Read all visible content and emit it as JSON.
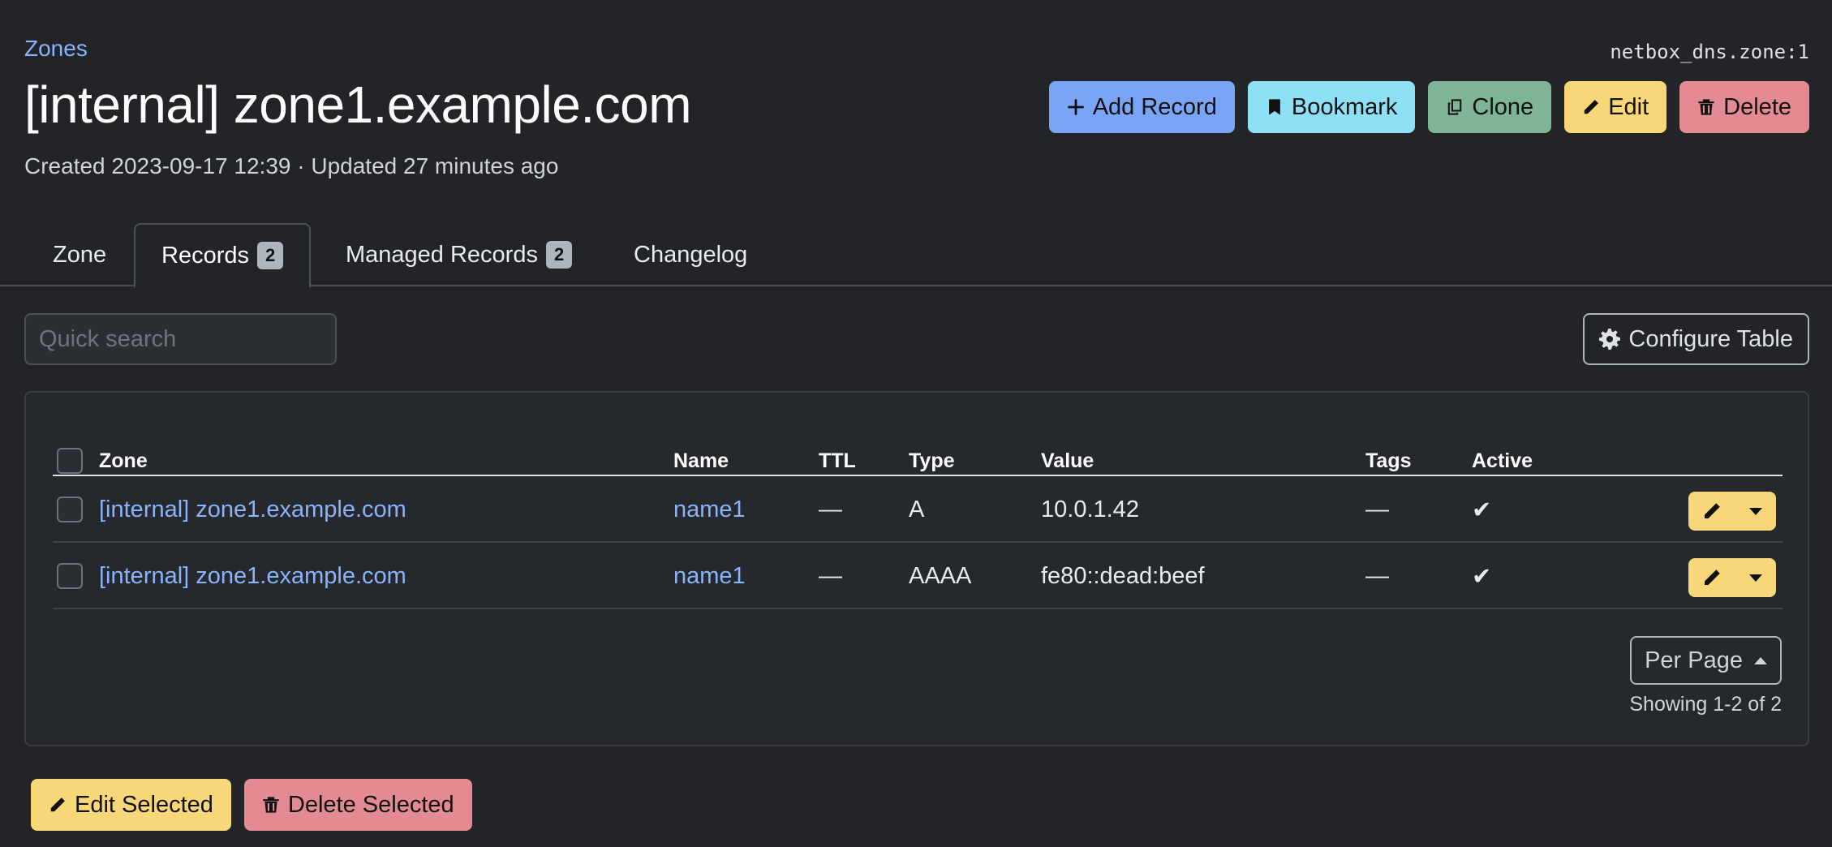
{
  "breadcrumb": "Zones",
  "object_id": "netbox_dns.zone:1",
  "title": "[internal] zone1.example.com",
  "meta": "Created 2023-09-17 12:39 · Updated 27 minutes ago",
  "actions": {
    "add_record": "Add Record",
    "bookmark": "Bookmark",
    "clone": "Clone",
    "edit": "Edit",
    "delete": "Delete"
  },
  "tabs": [
    {
      "label": "Zone",
      "badge": null
    },
    {
      "label": "Records",
      "badge": "2"
    },
    {
      "label": "Managed Records",
      "badge": "2"
    },
    {
      "label": "Changelog",
      "badge": null
    }
  ],
  "search": {
    "placeholder": "Quick search"
  },
  "configure_table": "Configure Table",
  "table": {
    "columns": [
      "Zone",
      "Name",
      "TTL",
      "Type",
      "Value",
      "Tags",
      "Active"
    ],
    "rows": [
      {
        "zone": "[internal] zone1.example.com",
        "name": "name1",
        "ttl": "—",
        "type": "A",
        "value": "10.0.1.42",
        "tags": "—",
        "active": "✔"
      },
      {
        "zone": "[internal] zone1.example.com",
        "name": "name1",
        "ttl": "—",
        "type": "AAAA",
        "value": "fe80::dead:beef",
        "tags": "—",
        "active": "✔"
      }
    ]
  },
  "pagination": {
    "per_page": "Per Page",
    "showing": "Showing 1-2 of 2"
  },
  "bulk": {
    "edit_selected": "Edit Selected",
    "delete_selected": "Delete Selected"
  },
  "colors": {
    "blue": "#7aa5f7",
    "cyan": "#8ee0f5",
    "green": "#7fb496",
    "yellow": "#f7d777",
    "red": "#e38a92",
    "link": "#8ab4f8"
  },
  "icons": [
    "plus-icon",
    "bookmark-icon",
    "clone-icon",
    "pencil-icon",
    "trash-icon",
    "gear-icon",
    "caret-down-icon",
    "caret-up-icon"
  ]
}
